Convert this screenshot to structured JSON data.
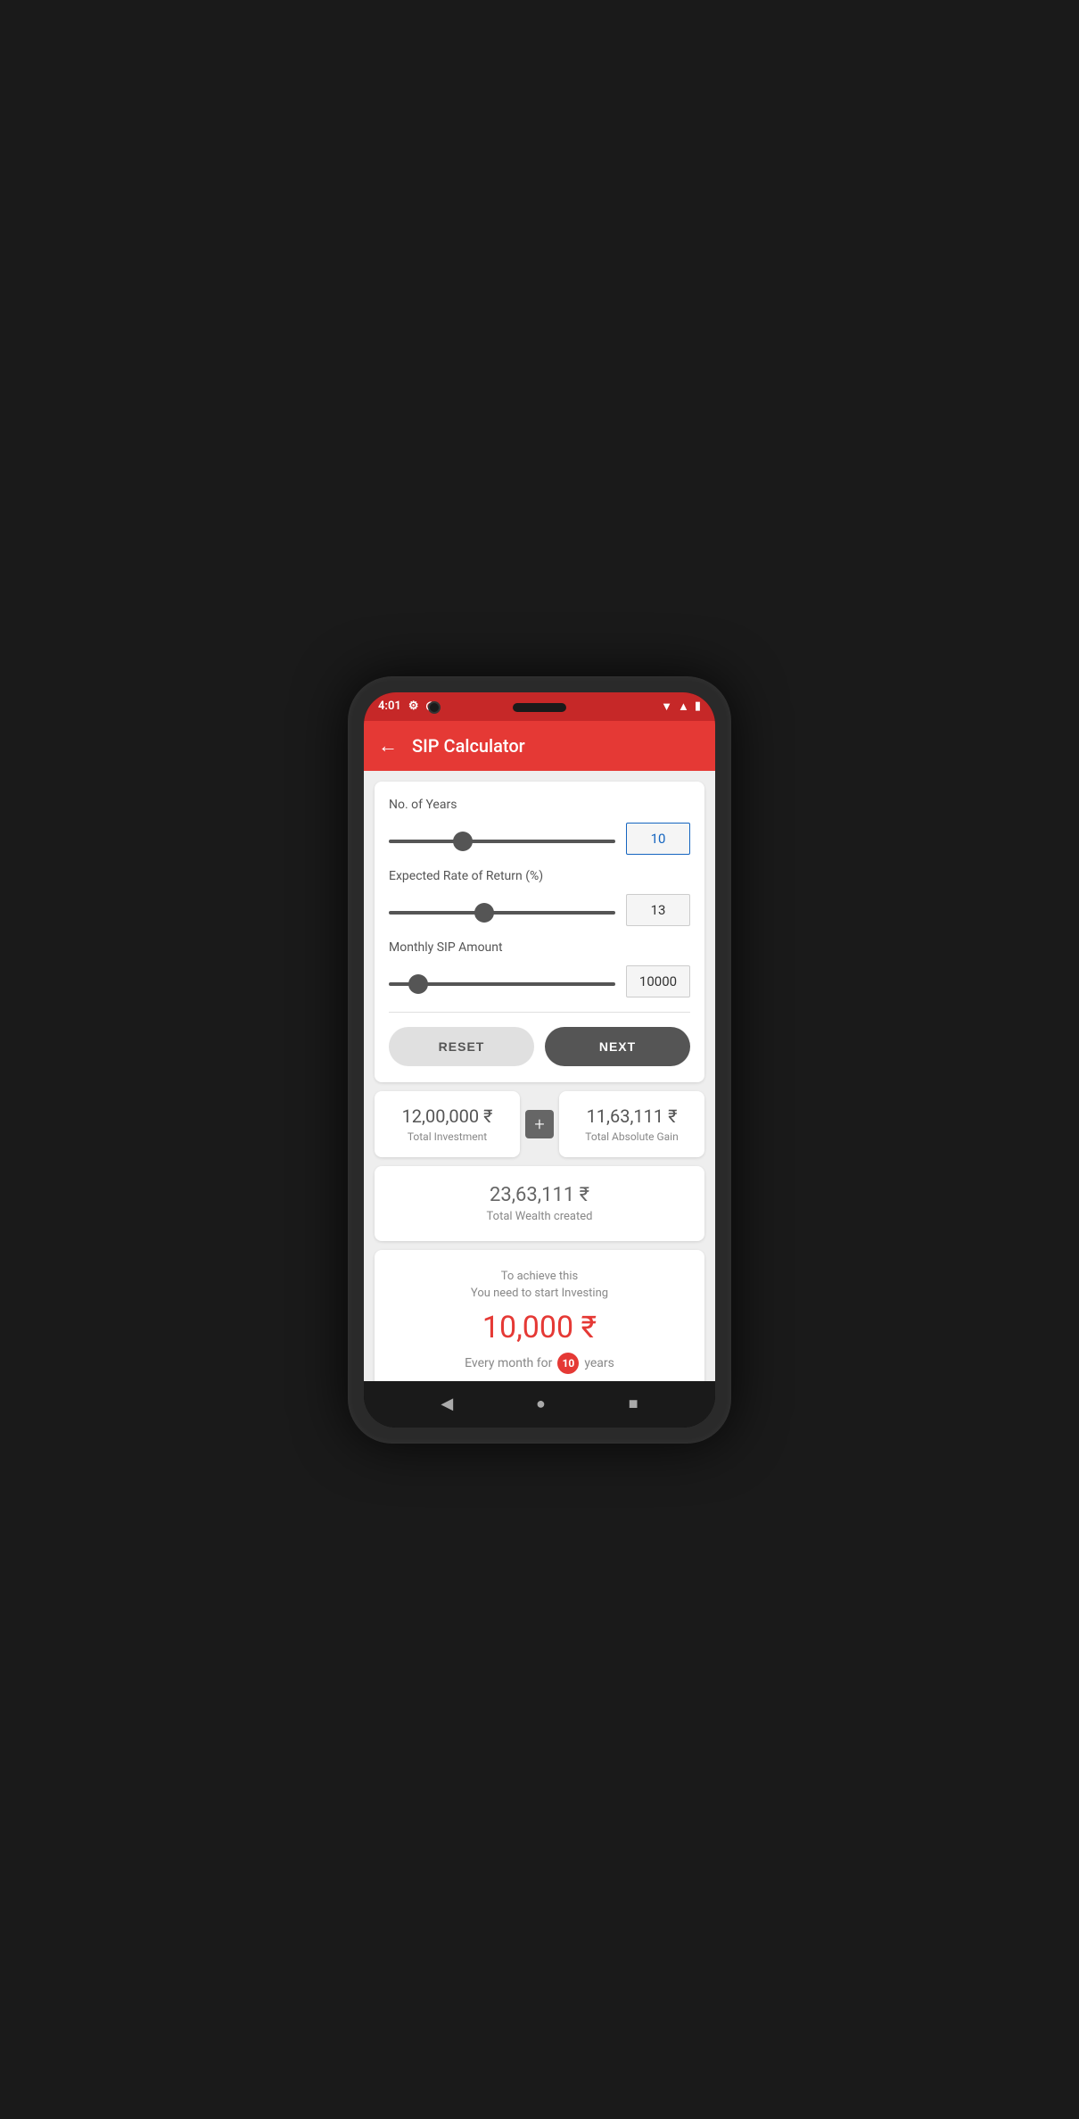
{
  "status_bar": {
    "time": "4:01",
    "icons": [
      "settings",
      "hotspot",
      "wifi",
      "signal",
      "battery"
    ]
  },
  "app_bar": {
    "title": "SIP Calculator",
    "back_label": "←"
  },
  "calculator": {
    "years_label": "No. of Years",
    "years_value": "10",
    "years_min": 1,
    "years_max": 30,
    "years_percent": 31,
    "rate_label": "Expected Rate of Return (%)",
    "rate_value": "13",
    "rate_min": 1,
    "rate_max": 30,
    "rate_percent": 43,
    "sip_label": "Monthly SIP Amount",
    "sip_value": "10000",
    "sip_min": 500,
    "sip_max": 100000,
    "sip_percent": 9,
    "reset_label": "RESET",
    "next_label": "NEXT"
  },
  "results": {
    "investment_amount": "12,00,000",
    "investment_label": "Total Investment",
    "gain_amount": "11,63,111",
    "gain_label": "Total Absolute Gain",
    "wealth_amount": "23,63,111",
    "wealth_label": "Total Wealth created",
    "achieve_line1": "To achieve this",
    "achieve_line2": "You need to start Investing",
    "achieve_amount": "10,000",
    "achieve_footer_pre": "Every month for",
    "achieve_years": "10",
    "achieve_footer_post": "years"
  },
  "nav_bar": {
    "back": "◀",
    "home": "●",
    "recents": "■"
  }
}
